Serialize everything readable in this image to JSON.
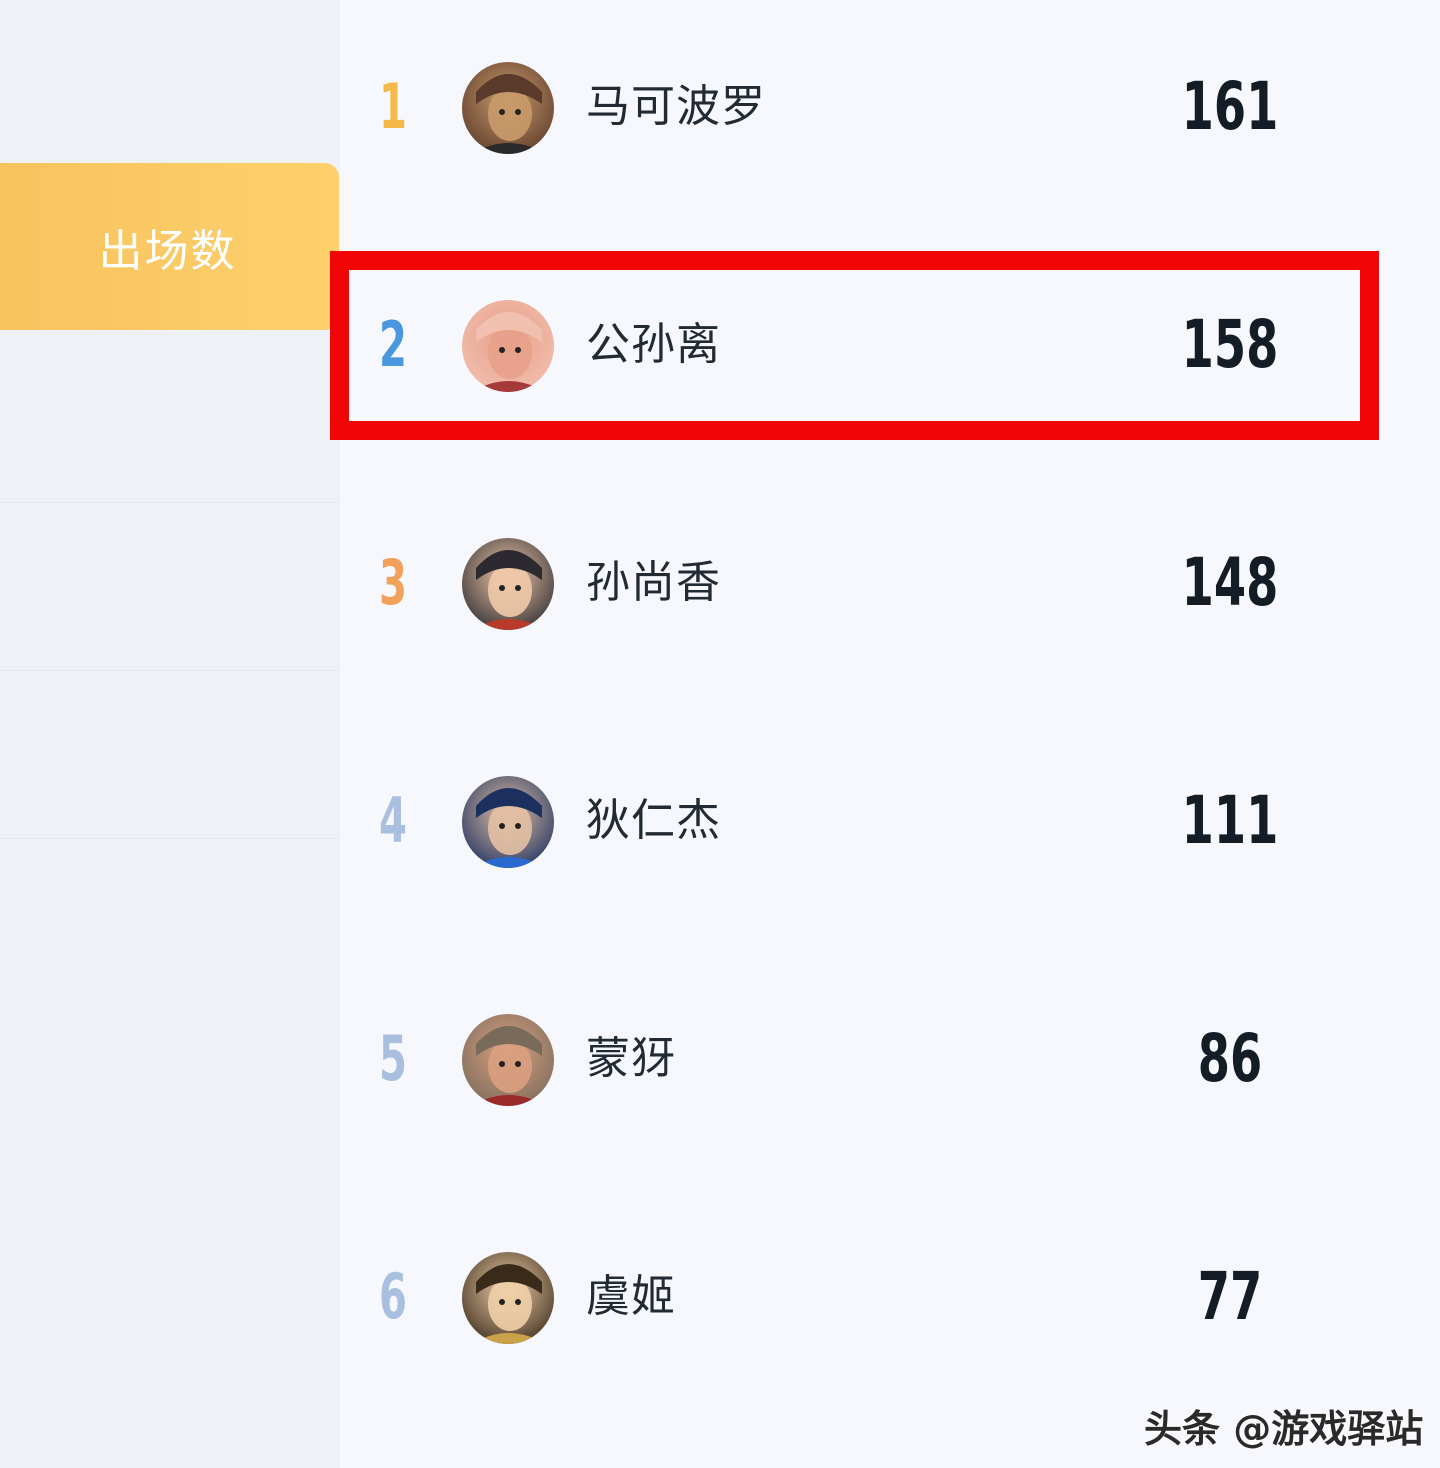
{
  "sidebar": {
    "active_tab_label": "出场数"
  },
  "ranking": [
    {
      "rank": "1",
      "rank_color": "#f5b84a",
      "name": "马可波罗",
      "count": "161",
      "avatar_colors": [
        "#5a3a2a",
        "#c99a6a",
        "#2a2a2a"
      ]
    },
    {
      "rank": "2",
      "rank_color": "#4a97e0",
      "name": "公孙离",
      "count": "158",
      "avatar_colors": [
        "#f2c0b0",
        "#e8a08a",
        "#a43a3a"
      ]
    },
    {
      "rank": "3",
      "rank_color": "#f3a05a",
      "name": "孙尚香",
      "count": "148",
      "avatar_colors": [
        "#2c2a30",
        "#f0c9a8",
        "#b83a2a"
      ]
    },
    {
      "rank": "4",
      "rank_color": "#a9bfe0",
      "name": "狄仁杰",
      "count": "111",
      "avatar_colors": [
        "#1c3060",
        "#e3c0a4",
        "#2a6ad0"
      ]
    },
    {
      "rank": "5",
      "rank_color": "#a9bfe0",
      "name": "蒙犽",
      "count": "86",
      "avatar_colors": [
        "#7a6a5a",
        "#d9a080",
        "#9a2a2a"
      ]
    },
    {
      "rank": "6",
      "rank_color": "#a9bfe0",
      "name": "虞姬",
      "count": "77",
      "avatar_colors": [
        "#3a2a1a",
        "#efcfa8",
        "#c9a24a"
      ]
    }
  ],
  "highlight_color": "#f20505",
  "watermark": "头条 @游戏驿站"
}
